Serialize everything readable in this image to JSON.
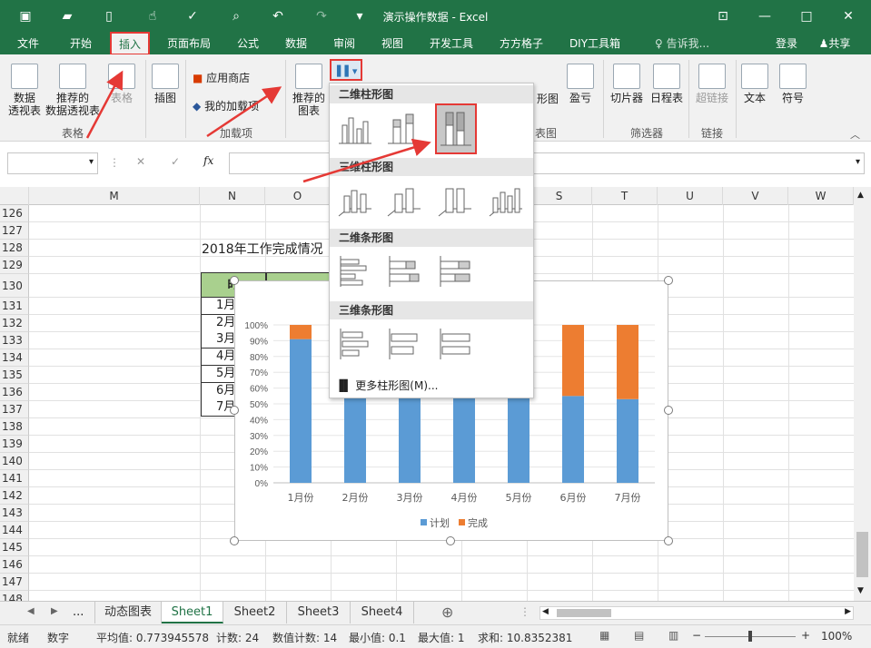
{
  "window": {
    "title": "演示操作数据 - Excel",
    "accent": "#217346"
  },
  "ribbon_tabs": [
    "文件",
    "开始",
    "插入",
    "页面布局",
    "公式",
    "数据",
    "审阅",
    "视图",
    "开发工具",
    "方方格子",
    "DIY工具箱"
  ],
  "tell_me": "告诉我...",
  "login": "登录",
  "share": "共享",
  "ribbon": {
    "pivot": "数据\n透视表",
    "recommended_pivot": "推荐的\n数据透视表",
    "table": "表格",
    "illustrations": "插图",
    "app_store": "应用商店",
    "my_addins": "我的加载项",
    "recommended_charts": "推荐的\n图表",
    "shapes_chart": "形图",
    "win_loss": "盈亏",
    "slicer": "切片器",
    "timeline": "日程表",
    "hyperlink": "超链接",
    "text": "文本",
    "symbols": "符号",
    "group_tables": "表格",
    "group_addins": "加载项",
    "group_charts": "图表",
    "group_filters": "筛选器",
    "group_links": "链接"
  },
  "formula_bar": {
    "name_box": "",
    "fx": "fx",
    "cancel": "✕",
    "confirm": "✓"
  },
  "columns": [
    "M",
    "N",
    "O",
    "P",
    "Q",
    "R",
    "S",
    "T",
    "U",
    "V",
    "W"
  ],
  "rows": [
    "126",
    "127",
    "128",
    "129",
    "130",
    "131",
    "132",
    "133",
    "134",
    "135",
    "136",
    "137",
    "138",
    "139",
    "140",
    "141",
    "142",
    "143",
    "144",
    "145",
    "146",
    "147",
    "148"
  ],
  "cells": {
    "title": "2018年工作完成情况",
    "header": "时",
    "months": [
      "1月",
      "2月",
      "3月",
      "4月",
      "5月",
      "6月",
      "7月"
    ]
  },
  "dropdown": {
    "sec_2d_column": "二维柱形图",
    "sec_3d_column": "三维柱形图",
    "sec_2d_bar": "二维条形图",
    "sec_3d_bar": "三维条形图",
    "more": "更多柱形图(M)..."
  },
  "chart_data": {
    "type": "bar",
    "stacked": true,
    "categories": [
      "1月份",
      "2月份",
      "3月份",
      "4月份",
      "5月份",
      "6月份",
      "7月份"
    ],
    "series": [
      {
        "name": "计划",
        "color": "#5b9bd5",
        "values": [
          0.91,
          0.61,
          0.62,
          0.6,
          0.6,
          0.55,
          0.53
        ]
      },
      {
        "name": "完成",
        "color": "#ed7d31",
        "values": [
          0.09,
          0.39,
          0.38,
          0.4,
          0.4,
          0.45,
          0.47
        ]
      }
    ],
    "ylim": [
      0,
      1
    ],
    "yticks": [
      "0%",
      "10%",
      "20%",
      "30%",
      "40%",
      "50%",
      "60%",
      "70%",
      "80%",
      "90%",
      "100%"
    ],
    "legend": "bottom"
  },
  "sheets": [
    "动态图表",
    "Sheet1",
    "Sheet2",
    "Sheet3",
    "Sheet4"
  ],
  "active_sheet": "Sheet1",
  "ellipsis": "...",
  "status": {
    "ready": "就绪",
    "mode": "数字",
    "average": "平均值: 0.773945578",
    "count": "计数: 24",
    "numcount": "数值计数: 14",
    "min": "最小值: 0.1",
    "max": "最大值: 1",
    "sum": "求和: 10.8352381",
    "zoom": "100%"
  }
}
